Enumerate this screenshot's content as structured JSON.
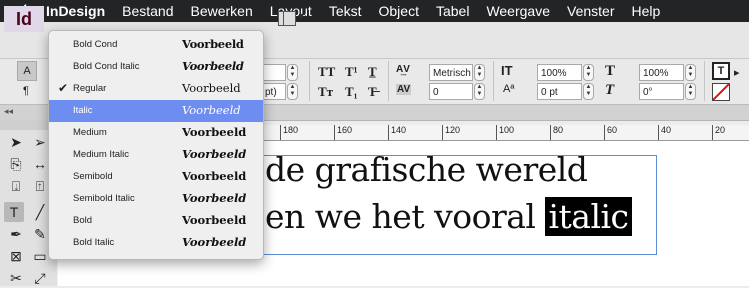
{
  "menubar": {
    "app": "InDesign",
    "items": [
      "Bestand",
      "Bewerken",
      "Layout",
      "Tekst",
      "Object",
      "Tabel",
      "Weergave",
      "Venster",
      "Help"
    ]
  },
  "appbar": {
    "logo": "Id"
  },
  "control": {
    "char_mode": "A",
    "para_mode": "¶",
    "font_size_unit_hint": "pt)",
    "tracking_method": "Metrisch",
    "kerning_value": "0",
    "vscale": "100%",
    "hscale": "100%",
    "baseline": "0 pt",
    "skew": "0°",
    "case_buttons": [
      "TT",
      "T¹",
      "T̲",
      "Tт",
      "T₁",
      "T̶"
    ]
  },
  "ruler": {
    "marks": [
      "180",
      "160",
      "140",
      "120",
      "100",
      "80",
      "60",
      "40",
      "20"
    ]
  },
  "vruler": {
    "mark": "4"
  },
  "document": {
    "line1": "de grafische wereld",
    "line2_prefix": "en we het vooral ",
    "line2_highlight": "italic"
  },
  "font_menu": {
    "preview_word": "Voorbeeld",
    "styles": [
      {
        "name": "Bold Cond",
        "checked": false,
        "selected": false
      },
      {
        "name": "Bold Cond Italic",
        "checked": false,
        "selected": false
      },
      {
        "name": "Regular",
        "checked": true,
        "selected": false
      },
      {
        "name": "Italic",
        "checked": false,
        "selected": true
      },
      {
        "name": "Medium",
        "checked": false,
        "selected": false
      },
      {
        "name": "Medium Italic",
        "checked": false,
        "selected": false
      },
      {
        "name": "Semibold",
        "checked": false,
        "selected": false
      },
      {
        "name": "Semibold Italic",
        "checked": false,
        "selected": false
      },
      {
        "name": "Bold",
        "checked": false,
        "selected": false
      },
      {
        "name": "Bold Italic",
        "checked": false,
        "selected": false
      }
    ]
  },
  "colors": {
    "menu_highlight": "#6d8ef0",
    "menubar": "#222426",
    "frame": "#5a8fd8"
  }
}
